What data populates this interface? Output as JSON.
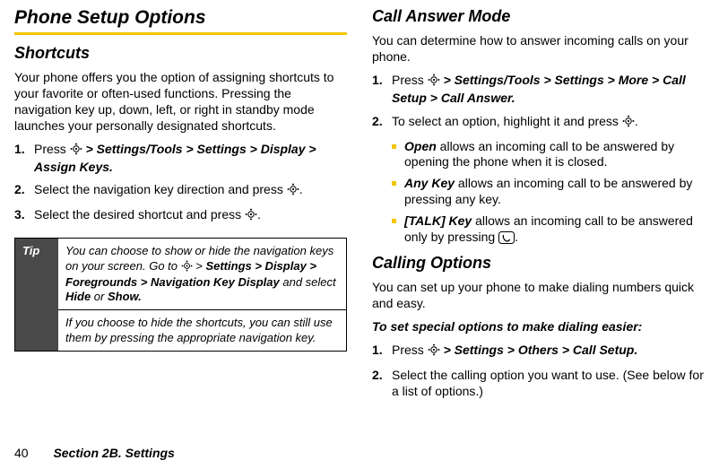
{
  "left": {
    "title": "Phone Setup Options",
    "h2": "Shortcuts",
    "intro": "Your phone offers you the option of assigning shortcuts to your favorite or often-used functions. Pressing the navigation key up, down, left, or right in standby mode launches your personally designated shortcuts.",
    "steps": {
      "s1a": "Press ",
      "s1b": " > Settings/Tools > Settings > Display > Assign Keys.",
      "s2a": "Select the navigation key direction and press ",
      "s2b": ".",
      "s3a": "Select the desired shortcut and press ",
      "s3b": "."
    },
    "tip": {
      "label": "Tip",
      "row1a": "You can choose to show or hide the navigation keys on your screen. Go to ",
      "row1b": " > ",
      "row1c": "Settings > Display > Foregrounds > Navigation Key Display",
      "row1d": " and select ",
      "row1e": "Hide",
      "row1f": " or ",
      "row1g": "Show.",
      "row2": "If you choose to hide the shortcuts, you can still use them by pressing the appropriate navigation key."
    }
  },
  "right": {
    "h2a": "Call Answer Mode",
    "p1": "You can determine how to answer incoming calls on your phone.",
    "steps1": {
      "s1a": "Press ",
      "s1b": " > Settings/Tools > Settings > More > Call Setup > Call Answer.",
      "s2a": "To select an option, highlight it and press ",
      "s2b": "."
    },
    "bullets": {
      "b1a": "Open",
      "b1b": " allows an incoming call to be answered by opening the phone when it is closed.",
      "b2a": "Any Key",
      "b2b": " allows an incoming call to be answered by pressing any key.",
      "b3a": "[TALK] Key",
      "b3b": " allows an incoming call to be answered only by pressing ",
      "b3c": "."
    },
    "h2b": "Calling Options",
    "p2": "You can set up your phone to make dialing numbers quick and easy.",
    "p3": "To set special options to make dialing easier:",
    "steps2": {
      "s1a": "Press ",
      "s1b": " > Settings > Others > Call Setup.",
      "s2a": "Select the calling option you want to use. (See below for a list of options.)"
    }
  },
  "footer": {
    "page": "40",
    "section": "Section 2B. Settings"
  }
}
